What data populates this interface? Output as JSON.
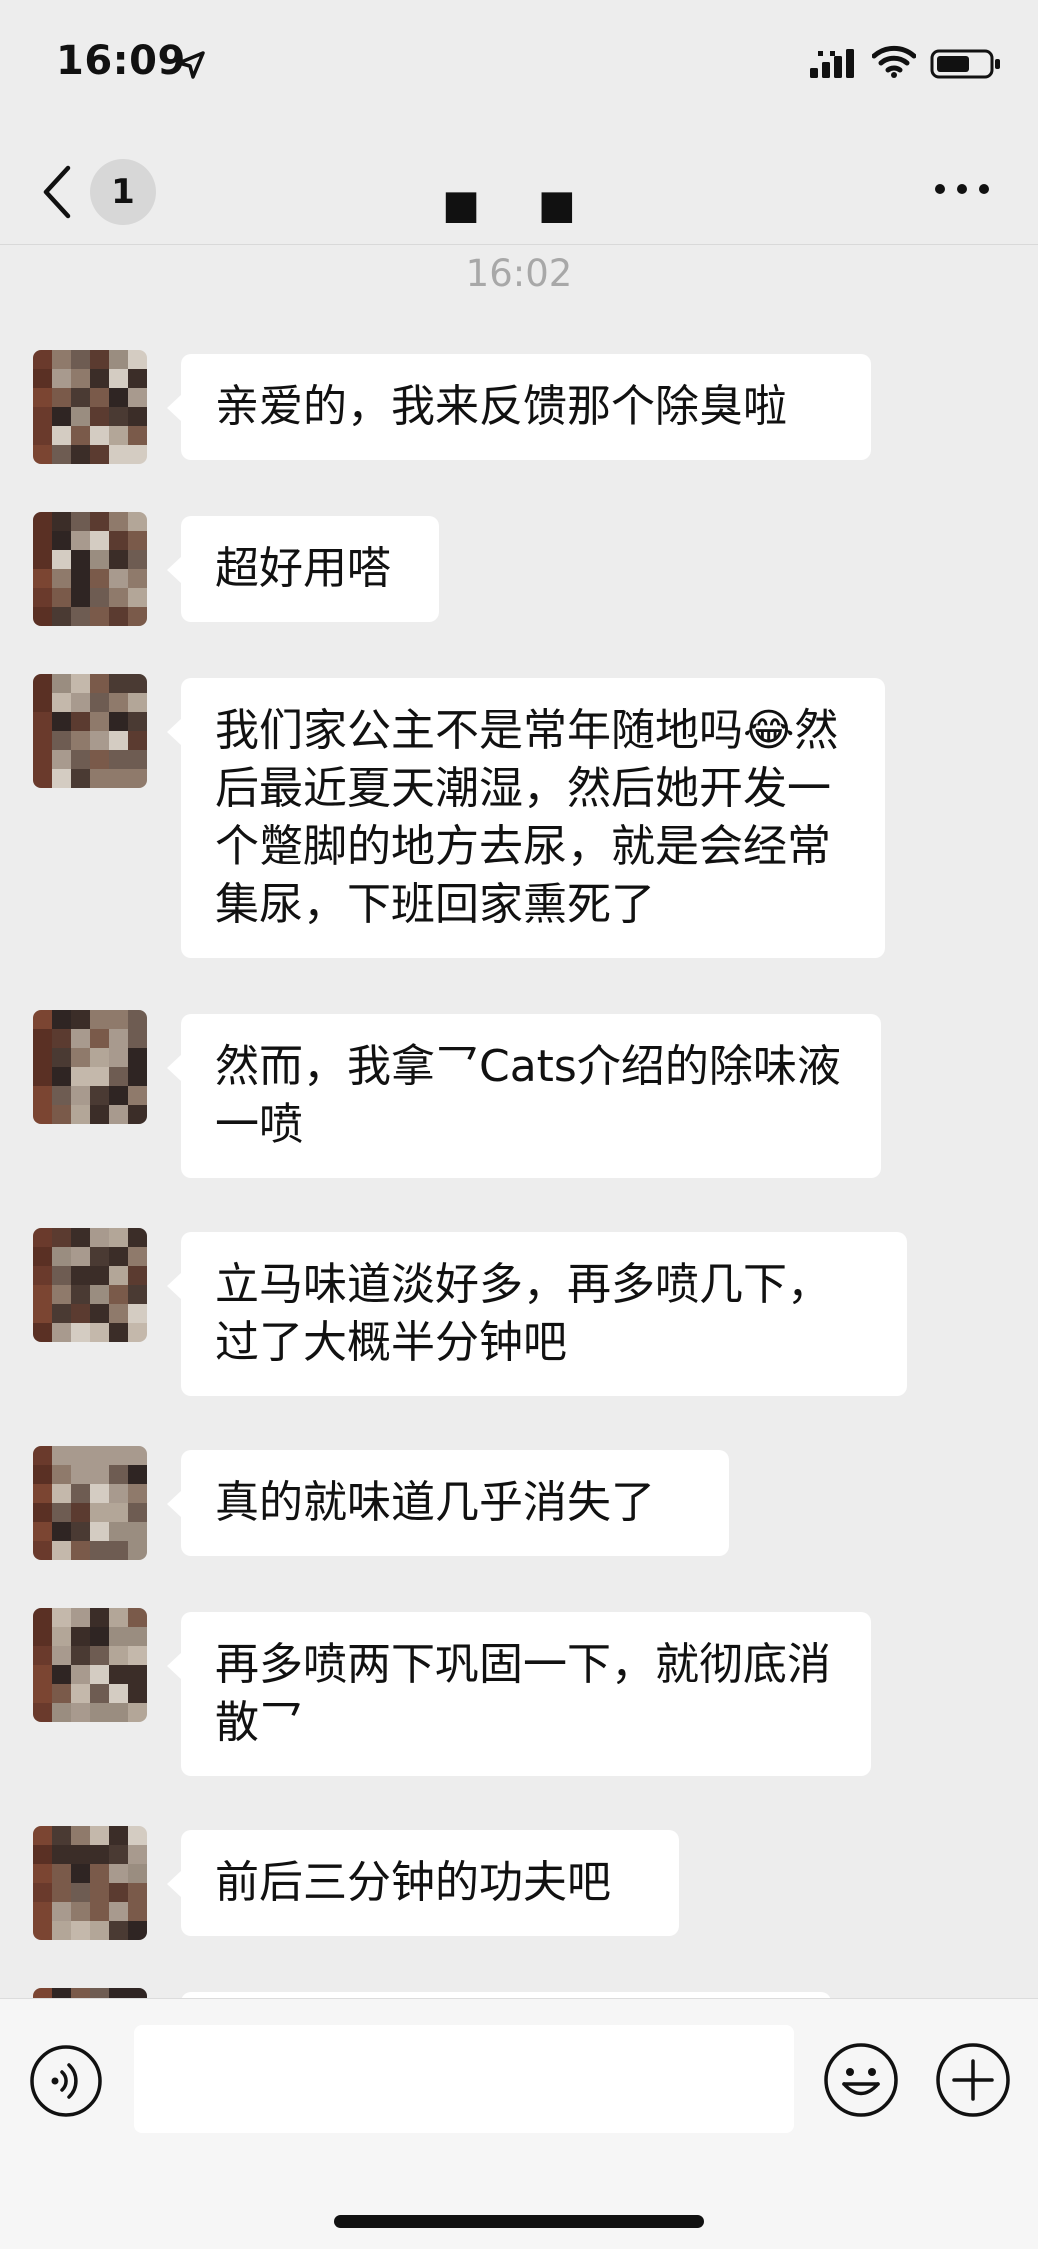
{
  "status_bar": {
    "time": "16:09"
  },
  "nav": {
    "badge": "1",
    "title": "■ ■"
  },
  "timestamp": "16:02",
  "messages": [
    {
      "text": "亲爱的，我来反馈那个除臭啦"
    },
    {
      "text": "超好用嗒"
    },
    {
      "text": "我们家公主不是常年随地吗😂然后最近夏天潮湿，然后她开发一个蹩脚的地方去尿，就是会经常集尿，下班回家熏死了"
    },
    {
      "text": "然而，我拿乛Cats介绍的除味液一喷"
    },
    {
      "text": "立马味道淡好多，再多喷几下，过了大概半分钟吧"
    },
    {
      "text": "真的就味道几乎消失了"
    },
    {
      "text": "再多喷两下巩固一下，就彻底消散乛"
    },
    {
      "text": "前后三分钟的功夫吧"
    }
  ],
  "input": {
    "placeholder": ""
  },
  "colors": {
    "background": "#ededed",
    "bubble": "#ffffff",
    "timestamp": "#a8a8a8"
  }
}
